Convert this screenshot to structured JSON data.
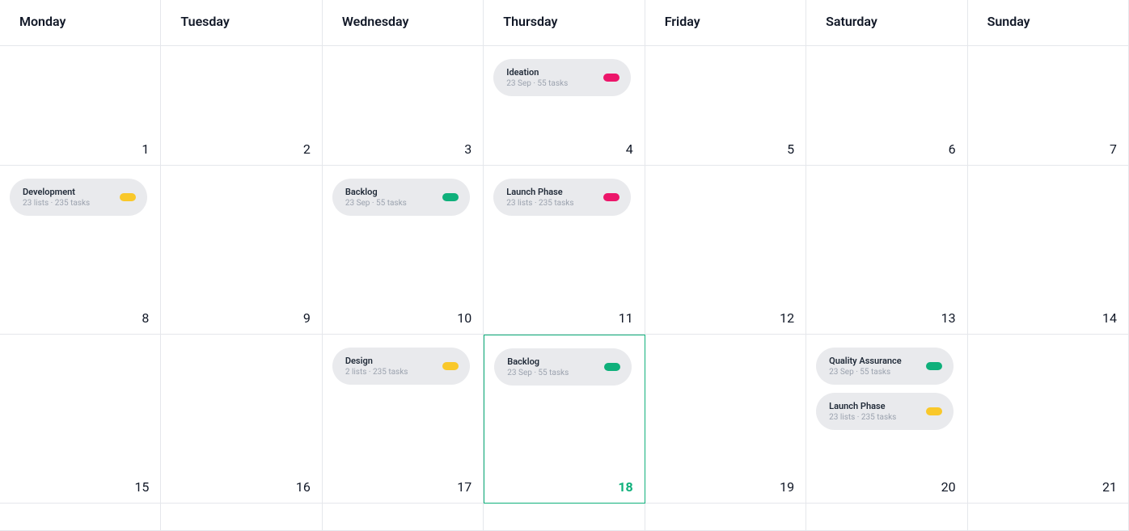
{
  "headers": [
    "Monday",
    "Tuesday",
    "Wednesday",
    "Thursday",
    "Friday",
    "Saturday",
    "Sunday"
  ],
  "colors": {
    "pink": "#ec166a",
    "green": "#0fb07b",
    "yellow": "#f9c82a"
  },
  "rows": [
    [
      {
        "num": 1,
        "events": []
      },
      {
        "num": 2,
        "events": []
      },
      {
        "num": 3,
        "events": []
      },
      {
        "num": 4,
        "events": [
          {
            "title": "Ideation",
            "meta": "23 Sep  ·  55 tasks",
            "color": "pink"
          }
        ]
      },
      {
        "num": 5,
        "events": []
      },
      {
        "num": 6,
        "events": []
      },
      {
        "num": 7,
        "events": []
      }
    ],
    [
      {
        "num": 8,
        "events": [
          {
            "title": "Development",
            "meta": "23 lists  ·  235 tasks",
            "color": "yellow"
          }
        ]
      },
      {
        "num": 9,
        "events": []
      },
      {
        "num": 10,
        "events": [
          {
            "title": "Backlog",
            "meta": "23 Sep  ·  55 tasks",
            "color": "green"
          }
        ]
      },
      {
        "num": 11,
        "events": [
          {
            "title": "Launch Phase",
            "meta": "23 lists  ·  235 tasks",
            "color": "pink"
          }
        ]
      },
      {
        "num": 12,
        "events": []
      },
      {
        "num": 13,
        "events": []
      },
      {
        "num": 14,
        "events": []
      }
    ],
    [
      {
        "num": 15,
        "events": []
      },
      {
        "num": 16,
        "events": []
      },
      {
        "num": 17,
        "events": [
          {
            "title": "Design",
            "meta": "2 lists  ·  235 tasks",
            "color": "yellow"
          }
        ]
      },
      {
        "num": 18,
        "today": true,
        "events": [
          {
            "title": "Backlog",
            "meta": "23 Sep  ·  55 tasks",
            "color": "green"
          }
        ]
      },
      {
        "num": 19,
        "events": []
      },
      {
        "num": 20,
        "events": [
          {
            "title": "Quality Assurance",
            "meta": "23 Sep  ·  55 tasks",
            "color": "green"
          },
          {
            "title": "Launch Phase",
            "meta": "23 lists  ·  235 tasks",
            "color": "yellow"
          }
        ]
      },
      {
        "num": 21,
        "events": []
      }
    ],
    [
      {
        "num": "",
        "events": []
      },
      {
        "num": "",
        "events": []
      },
      {
        "num": "",
        "events": []
      },
      {
        "num": "",
        "events": []
      },
      {
        "num": "",
        "events": []
      },
      {
        "num": "",
        "events": []
      },
      {
        "num": "",
        "events": []
      }
    ]
  ]
}
